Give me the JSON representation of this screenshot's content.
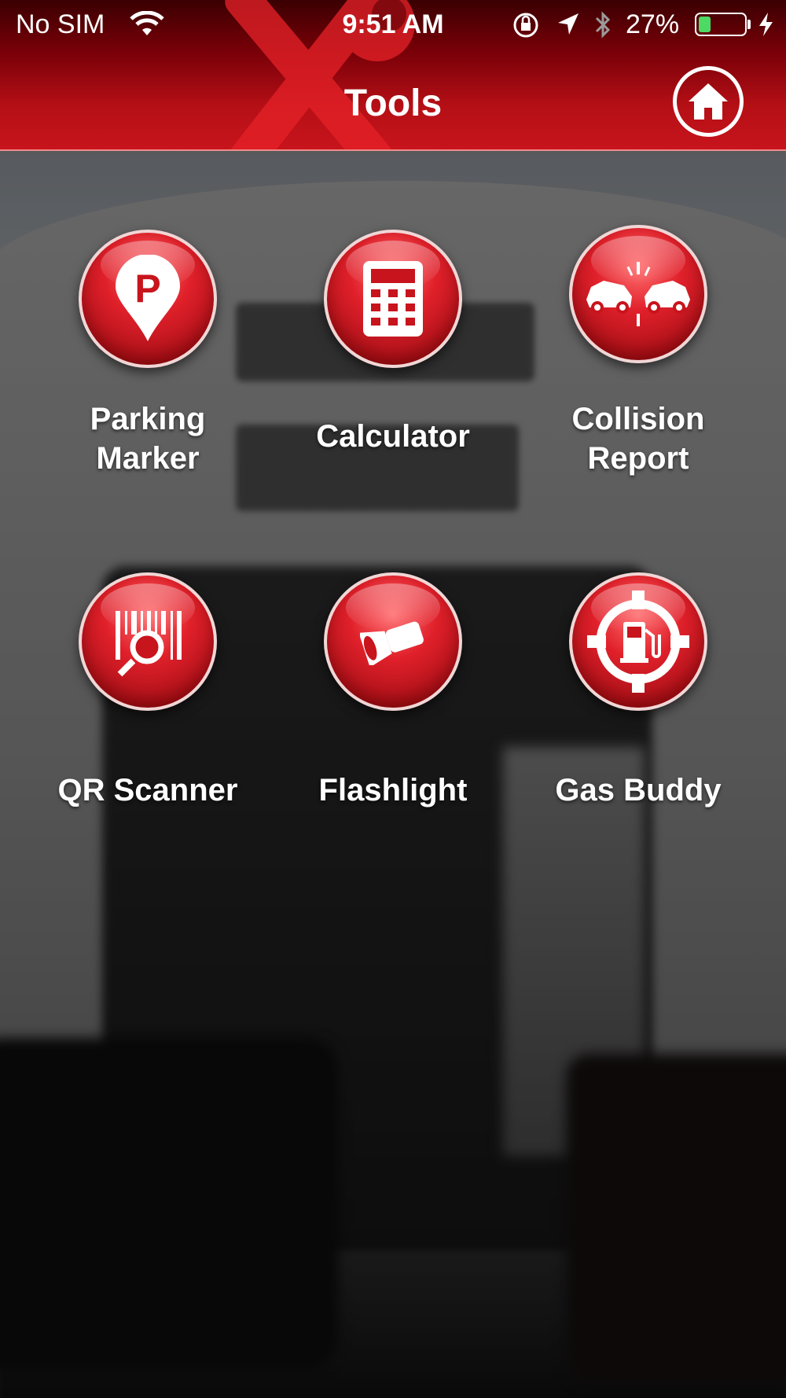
{
  "status_bar": {
    "carrier": "No SIM",
    "time": "9:51 AM",
    "battery_percent": "27%",
    "battery_level": 0.27,
    "icons": [
      "wifi-icon",
      "orientation-lock-icon",
      "location-arrow-icon",
      "bluetooth-icon",
      "battery-icon",
      "charging-bolt-icon"
    ]
  },
  "header": {
    "title": "Tools",
    "home_icon": "home-icon",
    "accent_color": "#c8141c"
  },
  "tools": [
    {
      "label": "Parking\nMarker",
      "icon": "parking-pin-icon"
    },
    {
      "label": "Calculator",
      "icon": "calculator-icon"
    },
    {
      "label": "Collision\nReport",
      "icon": "car-collision-icon"
    },
    {
      "label": "QR Scanner",
      "icon": "barcode-scan-icon"
    },
    {
      "label": "Flashlight",
      "icon": "flashlight-icon"
    },
    {
      "label": "Gas Buddy",
      "icon": "gas-pump-icon"
    }
  ]
}
